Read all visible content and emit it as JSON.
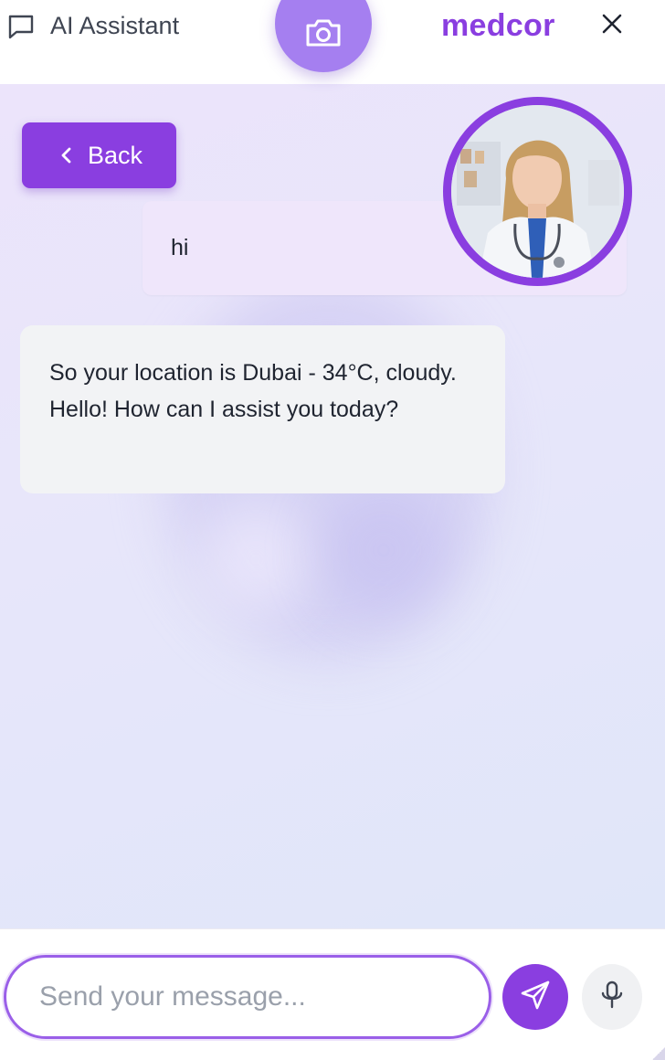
{
  "header": {
    "title": "AI Assistant",
    "brand": "medcor",
    "icons": {
      "chat": "chat-bubble-icon",
      "camera": "camera-icon",
      "close": "close-icon"
    }
  },
  "nav": {
    "back_label": "Back"
  },
  "messages": [
    {
      "role": "user",
      "text": "hi"
    },
    {
      "role": "assistant",
      "text": "So your location is Dubai - 34°C, cloudy. Hello! How can I assist you today?"
    }
  ],
  "composer": {
    "placeholder": "Send your message...",
    "value": ""
  },
  "colors": {
    "accent": "#8a3ee0",
    "camera_button": "#a57ff0",
    "user_bubble": "#efe6fb",
    "assistant_bubble": "#f2f3f5"
  }
}
